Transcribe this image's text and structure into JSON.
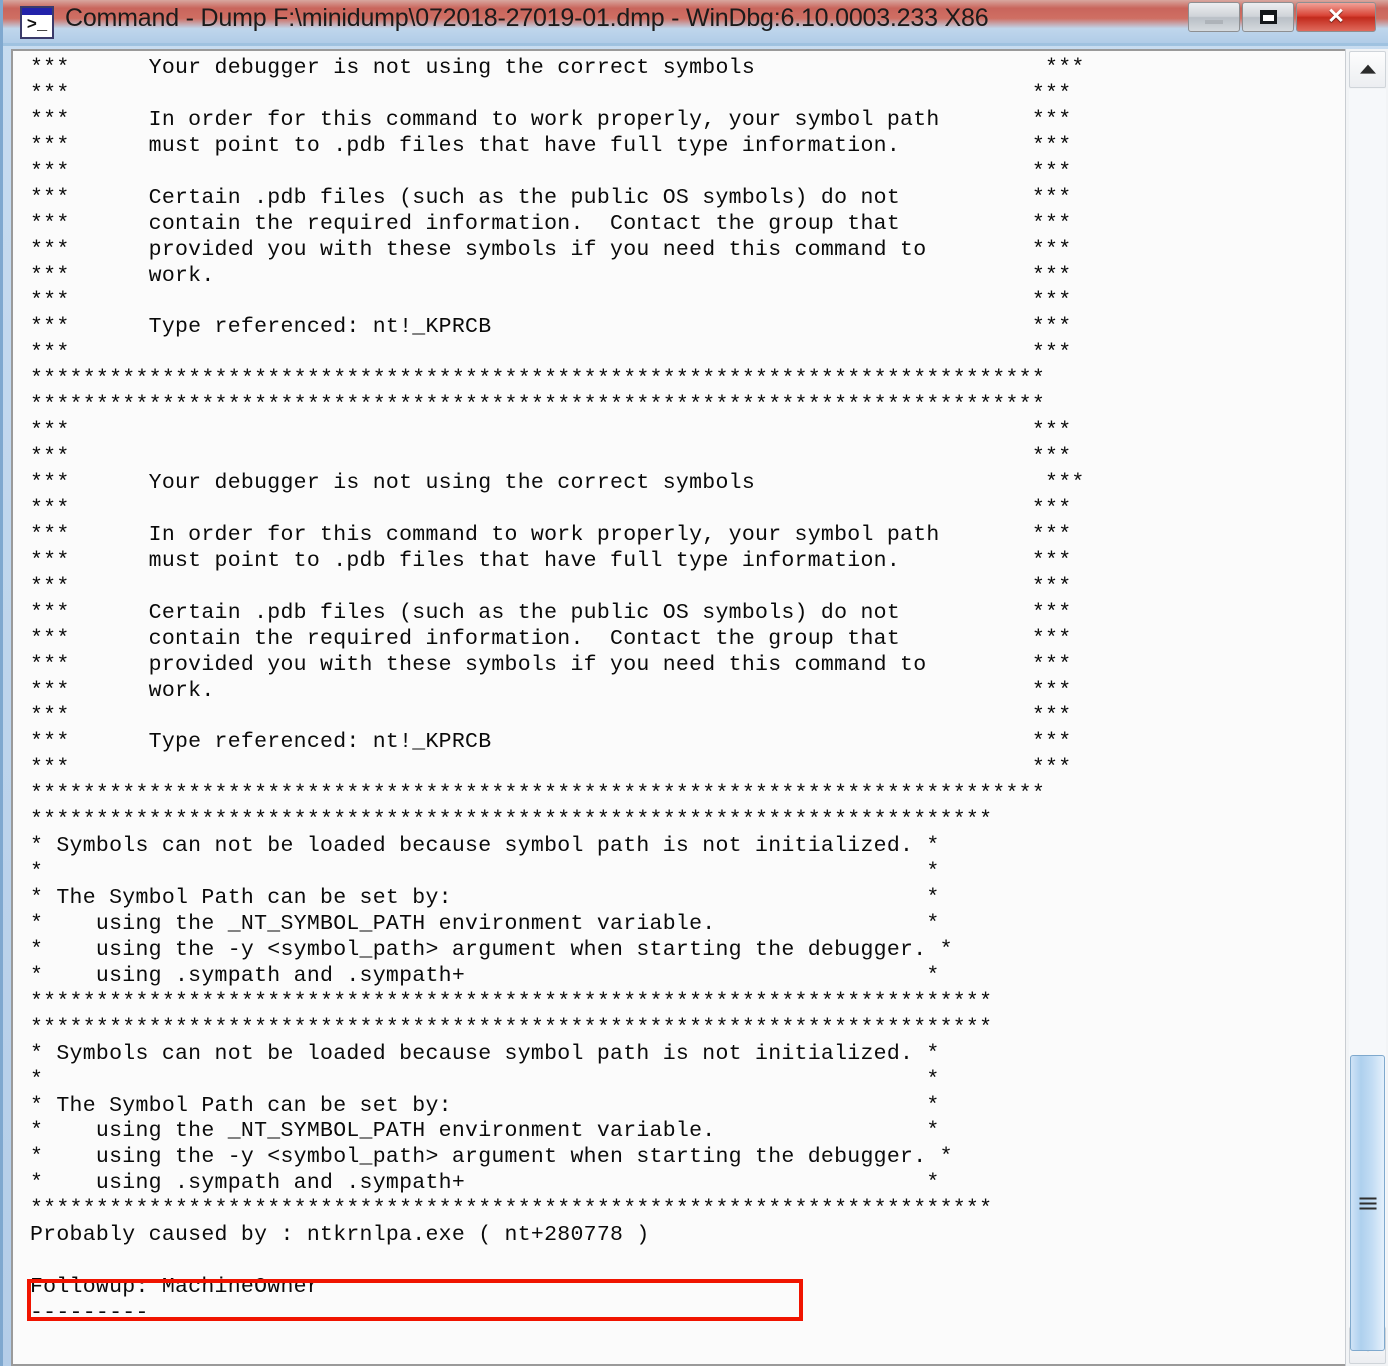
{
  "window": {
    "title": "Command - Dump F:\\minidump\\072018-27019-01.dmp - WinDbg:6.10.0003.233 X86",
    "icon": "console-prompt-icon",
    "icon_glyph": ">_",
    "controls": {
      "minimize_label": "",
      "maximize_label": "",
      "close_label": "✕"
    },
    "accent_color": "#c9655c",
    "highlight_color": "#f01400"
  },
  "console": {
    "lines": [
      "***      Your debugger is not using the correct symbols                      ***",
      "***                                                                         ***",
      "***      In order for this command to work properly, your symbol path       ***",
      "***      must point to .pdb files that have full type information.          ***",
      "***                                                                         ***",
      "***      Certain .pdb files (such as the public OS symbols) do not          ***",
      "***      contain the required information.  Contact the group that          ***",
      "***      provided you with these symbols if you need this command to        ***",
      "***      work.                                                              ***",
      "***                                                                         ***",
      "***      Type referenced: nt!_KPRCB                                         ***",
      "***                                                                         ***",
      "*****************************************************************************",
      "*****************************************************************************",
      "***                                                                         ***",
      "***                                                                         ***",
      "***      Your debugger is not using the correct symbols                      ***",
      "***                                                                         ***",
      "***      In order for this command to work properly, your symbol path       ***",
      "***      must point to .pdb files that have full type information.          ***",
      "***                                                                         ***",
      "***      Certain .pdb files (such as the public OS symbols) do not          ***",
      "***      contain the required information.  Contact the group that          ***",
      "***      provided you with these symbols if you need this command to        ***",
      "***      work.                                                              ***",
      "***                                                                         ***",
      "***      Type referenced: nt!_KPRCB                                         ***",
      "***                                                                         ***",
      "*****************************************************************************",
      "*************************************************************************",
      "* Symbols can not be loaded because symbol path is not initialized. *",
      "*                                                                   *",
      "* The Symbol Path can be set by:                                    *",
      "*    using the _NT_SYMBOL_PATH environment variable.                *",
      "*    using the -y <symbol_path> argument when starting the debugger. *",
      "*    using .sympath and .sympath+                                   *",
      "*************************************************************************",
      "*************************************************************************",
      "* Symbols can not be loaded because symbol path is not initialized. *",
      "*                                                                   *",
      "* The Symbol Path can be set by:                                    *",
      "*    using the _NT_SYMBOL_PATH environment variable.                *",
      "*    using the -y <symbol_path> argument when starting the debugger. *",
      "*    using .sympath and .sympath+                                   *",
      "*************************************************************************",
      "Probably caused by : ntkrnlpa.exe ( nt+280778 )",
      "",
      "Followup: MachineOwner",
      "---------"
    ],
    "highlighted_line": "Probably caused by : ntkrnlpa.exe ( nt+280778 )"
  },
  "scrollbar": {
    "up_arrow": "chevron-up-icon",
    "down_arrow": "chevron-down-icon",
    "thumb_grip": "grip-icon"
  }
}
